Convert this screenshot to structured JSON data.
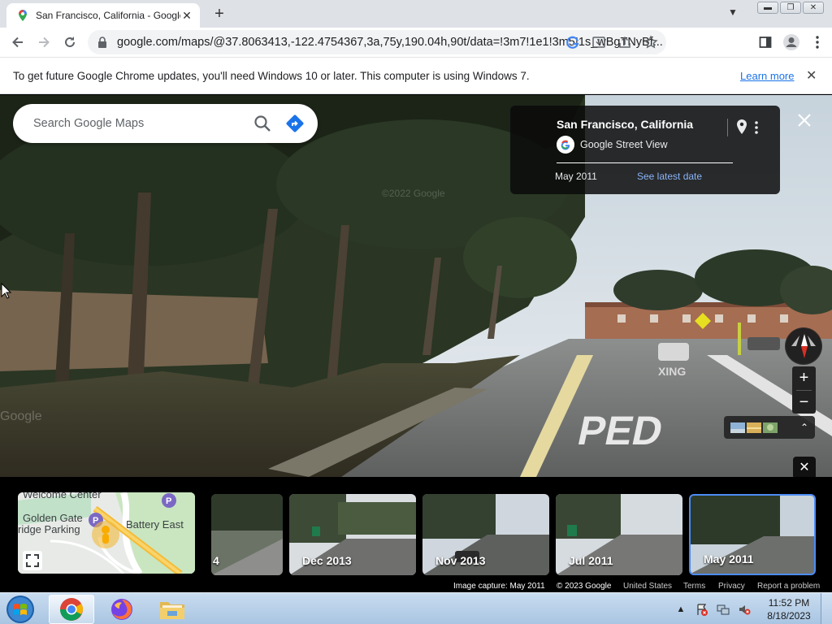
{
  "browser": {
    "tab_title": "San Francisco, California - Google Maps",
    "url": "google.com/maps/@37.8063413,-122.4754367,3a,75y,190.04h,90t/data=!3m7!1e1!3m5!1s_wBgTNyBf...",
    "infobar_message": "To get future Google Chrome updates, you'll need Windows 10 or later. This computer is using Windows 7.",
    "infobar_link": "Learn more"
  },
  "maps": {
    "search_placeholder": "Search Google Maps",
    "place_title": "San Francisco, California",
    "provider": "Google Street View",
    "capture_date": "May 2011",
    "latest_date_link": "See latest date",
    "minimap_labels": [
      "Welcome Center",
      "Golden Gate",
      "ridge Parking",
      "Battery East"
    ],
    "timeline": [
      {
        "label": "4"
      },
      {
        "label": "Dec 2013"
      },
      {
        "label": "Nov 2013"
      },
      {
        "label": "Jul 2011"
      },
      {
        "label": "May 2011",
        "selected": true
      }
    ],
    "footer": {
      "image_capture": "Image capture: May 2011",
      "copyright": "© 2023 Google",
      "country": "United States",
      "terms": "Terms",
      "privacy": "Privacy",
      "report": "Report a problem"
    }
  },
  "taskbar": {
    "time": "11:52 PM",
    "date": "8/18/2023"
  },
  "colors": {
    "link_blue": "#1a73e8",
    "latest_link": "#8ab4f8",
    "selected_thumb_border": "#4c8bf5",
    "card_bg": "#0a0a0a"
  }
}
